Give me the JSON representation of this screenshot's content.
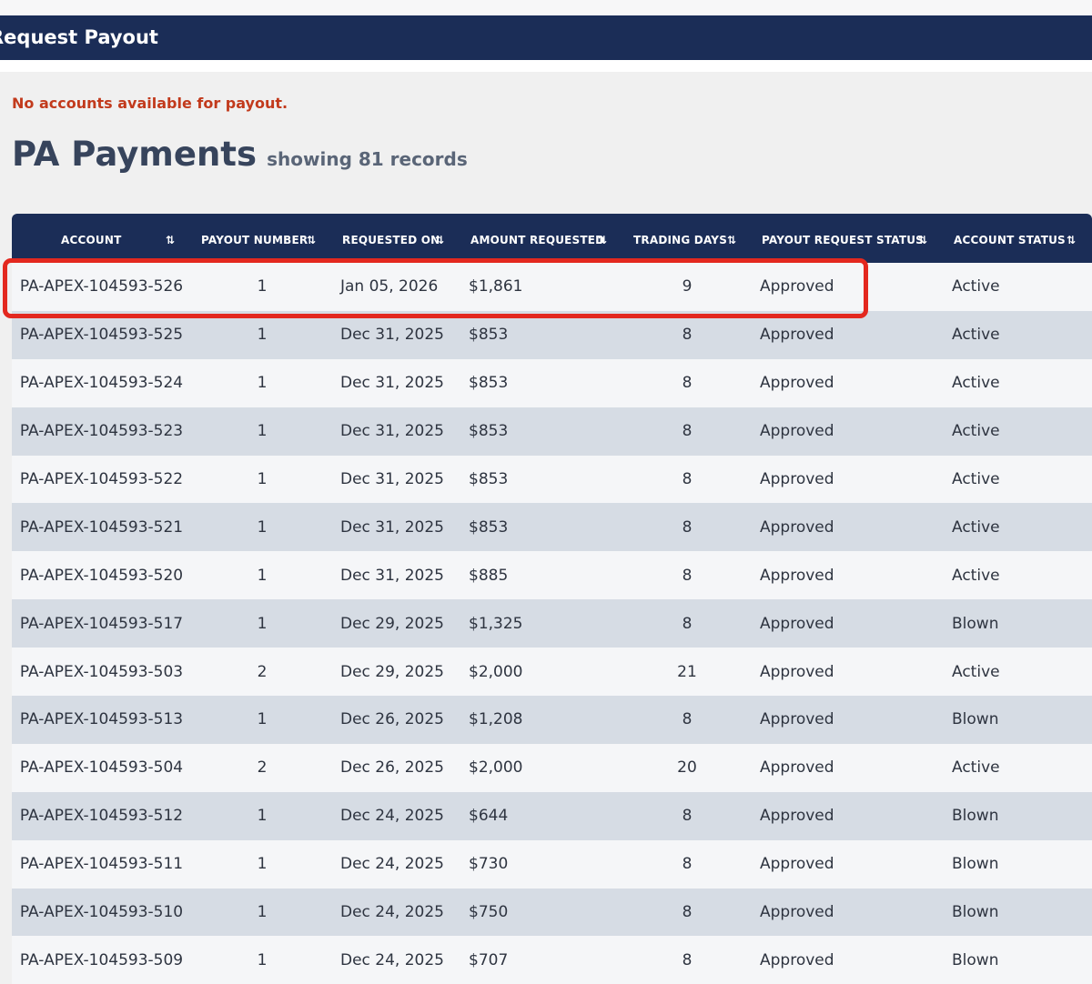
{
  "header": {
    "title": "Request Payout"
  },
  "notice": "No accounts available for payout.",
  "page": {
    "title": "PA Payments",
    "record_count": "showing 81 records"
  },
  "table": {
    "columns": [
      "ACCOUNT",
      "PAYOUT NUMBER",
      "REQUESTED ON",
      "AMOUNT REQUESTED",
      "TRADING DAYS",
      "PAYOUT REQUEST STATUS",
      "ACCOUNT STATUS"
    ],
    "sort_icon": "sort-arrows-icon",
    "rows": [
      [
        "PA-APEX-104593-526",
        "1",
        "Jan 05, 2026",
        "$1,861",
        "9",
        "Approved",
        "Active"
      ],
      [
        "PA-APEX-104593-525",
        "1",
        "Dec 31, 2025",
        "$853",
        "8",
        "Approved",
        "Active"
      ],
      [
        "PA-APEX-104593-524",
        "1",
        "Dec 31, 2025",
        "$853",
        "8",
        "Approved",
        "Active"
      ],
      [
        "PA-APEX-104593-523",
        "1",
        "Dec 31, 2025",
        "$853",
        "8",
        "Approved",
        "Active"
      ],
      [
        "PA-APEX-104593-522",
        "1",
        "Dec 31, 2025",
        "$853",
        "8",
        "Approved",
        "Active"
      ],
      [
        "PA-APEX-104593-521",
        "1",
        "Dec 31, 2025",
        "$853",
        "8",
        "Approved",
        "Active"
      ],
      [
        "PA-APEX-104593-520",
        "1",
        "Dec 31, 2025",
        "$885",
        "8",
        "Approved",
        "Active"
      ],
      [
        "PA-APEX-104593-517",
        "1",
        "Dec 29, 2025",
        "$1,325",
        "8",
        "Approved",
        "Blown"
      ],
      [
        "PA-APEX-104593-503",
        "2",
        "Dec 29, 2025",
        "$2,000",
        "21",
        "Approved",
        "Active"
      ],
      [
        "PA-APEX-104593-513",
        "1",
        "Dec 26, 2025",
        "$1,208",
        "8",
        "Approved",
        "Blown"
      ],
      [
        "PA-APEX-104593-504",
        "2",
        "Dec 26, 2025",
        "$2,000",
        "20",
        "Approved",
        "Active"
      ],
      [
        "PA-APEX-104593-512",
        "1",
        "Dec 24, 2025",
        "$644",
        "8",
        "Approved",
        "Blown"
      ],
      [
        "PA-APEX-104593-511",
        "1",
        "Dec 24, 2025",
        "$730",
        "8",
        "Approved",
        "Blown"
      ],
      [
        "PA-APEX-104593-510",
        "1",
        "Dec 24, 2025",
        "$750",
        "8",
        "Approved",
        "Blown"
      ],
      [
        "PA-APEX-104593-509",
        "1",
        "Dec 24, 2025",
        "$707",
        "8",
        "Approved",
        "Blown"
      ]
    ],
    "highlighted_row": 0
  },
  "colors": {
    "header_bg": "#1b2d57",
    "notice_text": "#c23a1c",
    "highlight_border": "#e3281f",
    "row_odd": "#f5f6f8",
    "row_even": "#d6dce4"
  }
}
